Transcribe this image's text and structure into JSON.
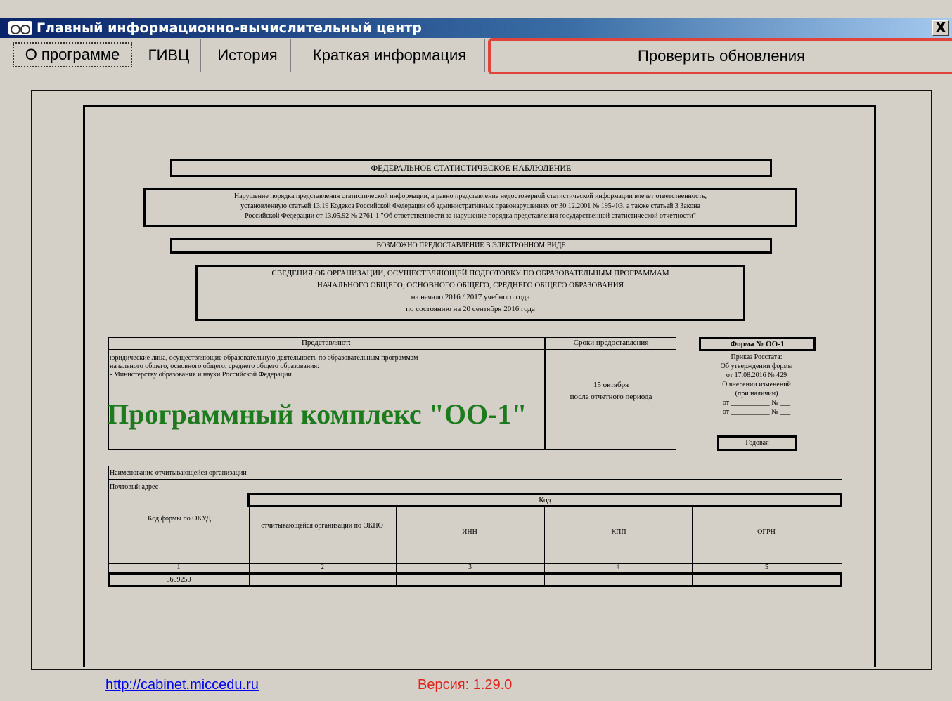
{
  "window": {
    "title": "Главный информационно-вычислительный центр",
    "close_label": "X"
  },
  "tabs": [
    {
      "label": "О программе"
    },
    {
      "label": "ГИВЦ"
    },
    {
      "label": "История"
    },
    {
      "label": "Краткая информация"
    }
  ],
  "update_button": {
    "label": "Проверить обновления"
  },
  "form": {
    "fed": "ФЕДЕРАЛЬНОЕ СТАТИСТИЧЕСКОЕ НАБЛЮДЕНИЕ",
    "notice": [
      "Нарушение порядка представления статистической информации, а равно представление недостоверной статистической информации влечет ответственность,",
      "установленную статьей 13.19 Кодекса Российской Федерации об административных правонарушениях от 30.12.2001 № 195-ФЗ, а также статьей 3 Закона",
      "Российской Федерации от 13.05.92 № 2761-1 \"Об ответственности за нарушение порядка представления государственной статистической отчетности\""
    ],
    "electronic": "ВОЗМОЖНО ПРЕДОСТАВЛЕНИЕ В ЭЛЕКТРОННОМ ВИДЕ",
    "info": [
      "СВЕДЕНИЯ ОБ ОРГАНИЗАЦИИ, ОСУЩЕСТВЛЯЮЩЕЙ ПОДГОТОВКУ ПО ОБРАЗОВАТЕЛЬНЫМ ПРОГРАММАМ",
      "НАЧАЛЬНОГО ОБЩЕГО, ОСНОВНОГО ОБЩЕГО, СРЕДНЕГО ОБЩЕГО ОБРАЗОВАНИЯ",
      "на начало   2016  /  2017  учебного года",
      "по состоянию на 20 сентября   2016 года"
    ],
    "provide_header": "Представляют:",
    "deadline_header": "Сроки предоставления",
    "subjects": [
      "юридические лица, осуществляющие образовательную деятельность по образовательным программам",
      "начального общего, основного общего, среднего общего образования:",
      "   - Министерству образования и науки Российской Федерации"
    ],
    "deadline": [
      "15 октября",
      "после отчетного периода"
    ],
    "program_title": "Программный комплекс \"ОО-1\"",
    "form_number": "Форма № ОО-1",
    "approve": [
      "Приказ Росстата:",
      "Об утверждении формы",
      "от  17.08.2016 № 429",
      "О внесении изменений",
      "(при наличии)",
      "от ___________ № ___",
      "от ___________ № ___"
    ],
    "yearly": "Годовая",
    "org_name": "Наименование отчитывающейся организации",
    "address": "Почтовый адрес",
    "code_header": "Код",
    "columns": [
      "Код формы по ОКУД",
      "отчитывающейся организации по ОКПО",
      "ИНН",
      "КПП",
      "ОГРН"
    ],
    "col_numbers": [
      "1",
      "2",
      "3",
      "4",
      "5"
    ],
    "okud_value": "0609250"
  },
  "footer": {
    "link": "http://cabinet.miccedu.ru",
    "version": "Версия: 1.29.0"
  }
}
